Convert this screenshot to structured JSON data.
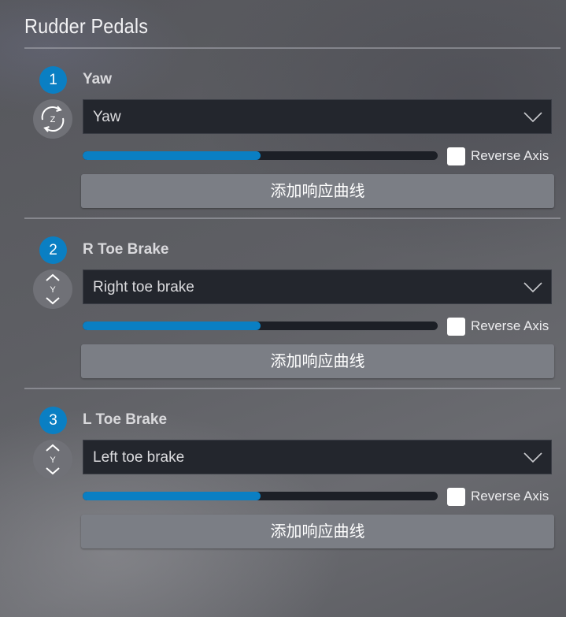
{
  "panel": {
    "title": "Rudder Pedals"
  },
  "accent_color": "#0a7fc3",
  "axes": [
    {
      "number": "1",
      "label": "Yaw",
      "axis_letter": "Z",
      "axis_icon": "rotate-z-icon",
      "selected": "Yaw",
      "level": 0.5,
      "reverse_label": "Reverse Axis",
      "reverse_checked": false,
      "curve_button": "添加响应曲线"
    },
    {
      "number": "2",
      "label": "R Toe Brake",
      "axis_letter": "Y",
      "axis_icon": "updown-y-icon",
      "selected": "Right toe brake",
      "level": 0.5,
      "reverse_label": "Reverse Axis",
      "reverse_checked": false,
      "curve_button": "添加响应曲线"
    },
    {
      "number": "3",
      "label": "L Toe Brake",
      "axis_letter": "Y",
      "axis_icon": "updown-y-icon",
      "selected": "Left toe brake",
      "level": 0.5,
      "reverse_label": "Reverse Axis",
      "reverse_checked": false,
      "curve_button": "添加响应曲线"
    }
  ]
}
